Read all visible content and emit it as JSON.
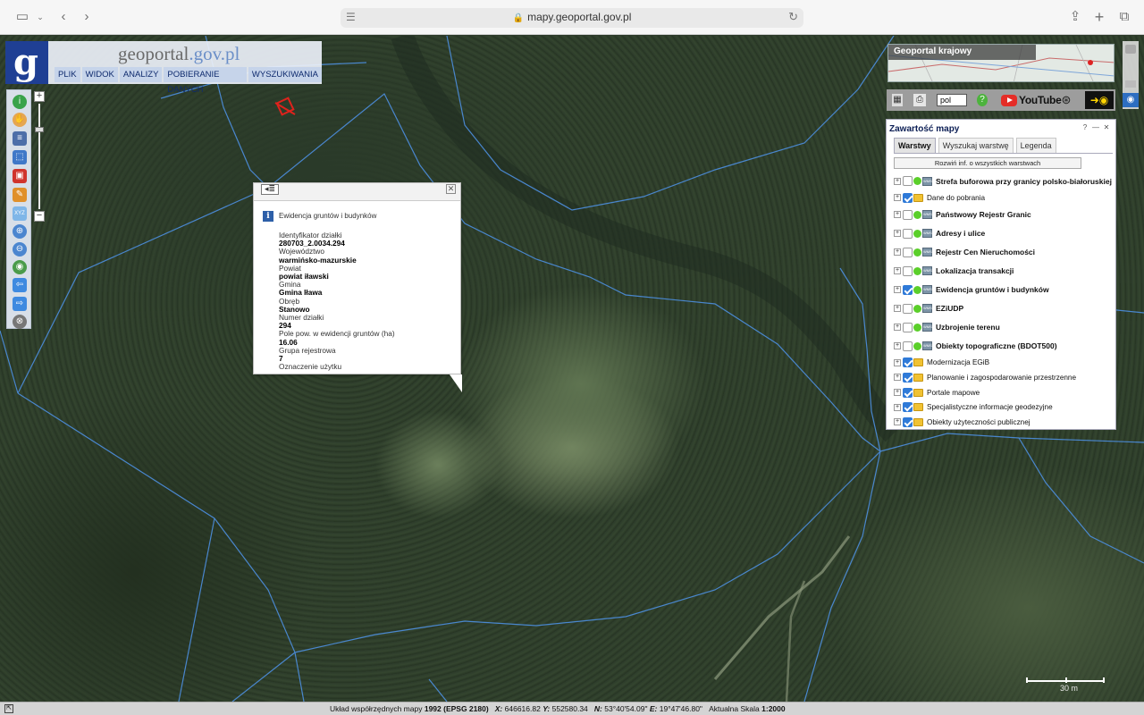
{
  "browser": {
    "url": "mapy.geoportal.gov.pl"
  },
  "header": {
    "brand_main": "geoportal",
    "brand_domain": ".gov.pl",
    "logo_letter": "g",
    "menu": [
      "PLIK",
      "WIDOK",
      "ANALIZY",
      "POBIERANIE DANYCH",
      "WYSZUKIWANIA"
    ]
  },
  "popup": {
    "title": "Ewidencja gruntów i budynków",
    "fields": [
      {
        "label": "Identyfikator działki",
        "value": "280703_2.0034.294"
      },
      {
        "label": "Województwo",
        "value": "warmińsko-mazurskie"
      },
      {
        "label": "Powiat",
        "value": "powiat iławski"
      },
      {
        "label": "Gmina",
        "value": "Gmina Iława"
      },
      {
        "label": "Obręb",
        "value": "Stanowo"
      },
      {
        "label": "Numer działki",
        "value": "294"
      },
      {
        "label": "Pole pow. w ewidencji gruntów (ha)",
        "value": "16.06"
      },
      {
        "label": "Grupa rejestrowa",
        "value": "7"
      },
      {
        "label": "Oznaczenie użytku",
        "value": ""
      }
    ]
  },
  "overview": {
    "label": "Geoportal krajowy"
  },
  "top_tools": {
    "language": "pol",
    "youtube_label": "YouTube"
  },
  "layers_panel": {
    "title": "Zawartość mapy",
    "tabs": [
      "Warstwy",
      "Wyszukaj warstwę",
      "Legenda"
    ],
    "active_tab": "Warstwy",
    "expand_button": "Rozwiń inf. o wszystkich warstwach",
    "layers": [
      {
        "label": "Strefa buforowa przy granicy polsko-białoruskiej",
        "checked": false,
        "type": "wms"
      },
      {
        "label": "Dane do pobrania",
        "checked": true,
        "type": "folder"
      },
      {
        "label": "Państwowy Rejestr Granic",
        "checked": false,
        "type": "wms"
      },
      {
        "label": "Adresy i ulice",
        "checked": false,
        "type": "wms"
      },
      {
        "label": "Rejestr Cen Nieruchomości",
        "checked": false,
        "type": "wms"
      },
      {
        "label": "Lokalizacja transakcji",
        "checked": false,
        "type": "wms"
      },
      {
        "label": "Ewidencja gruntów i budynków",
        "checked": true,
        "type": "wms"
      },
      {
        "label": "EZiUDP",
        "checked": false,
        "type": "wms"
      },
      {
        "label": "Uzbrojenie terenu",
        "checked": false,
        "type": "wms"
      },
      {
        "label": "Obiekty topograficzne (BDOT500)",
        "checked": false,
        "type": "wms"
      },
      {
        "label": "Modernizacja EGiB",
        "checked": true,
        "type": "folder"
      },
      {
        "label": "Planowanie i zagospodarowanie przestrzenne",
        "checked": true,
        "type": "folder"
      },
      {
        "label": "Portale mapowe",
        "checked": true,
        "type": "folder"
      },
      {
        "label": "Specjalistyczne informacje geodezyjne",
        "checked": true,
        "type": "folder"
      },
      {
        "label": "Obiekty użyteczności publicznej",
        "checked": true,
        "type": "folder"
      }
    ]
  },
  "scale_bar": {
    "label": "30 m"
  },
  "status": {
    "crs_label": "Układ współrzędnych mapy",
    "crs_value": "1992 (EPSG 2180)",
    "x_label": "X:",
    "x_value": "646616.82",
    "y_label": "Y:",
    "y_value": "552580.34",
    "n_label": "N:",
    "n_value": "53°40'54.09\"",
    "e_label": "E:",
    "e_value": "19°47'46.80\"",
    "scale_label": "Aktualna Skala",
    "scale_value": "1:2000"
  },
  "colors": {
    "parcel_lines": "#4d8fe0",
    "selected_parcel": "#e0221c",
    "brand_blue": "#1f3f94"
  }
}
